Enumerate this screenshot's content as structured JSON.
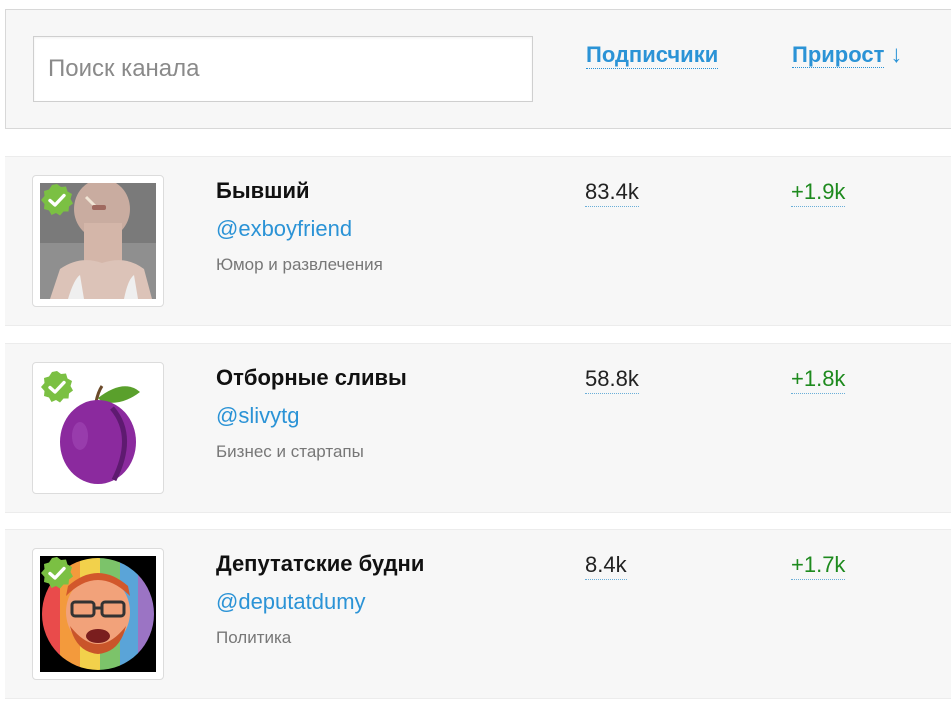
{
  "search": {
    "placeholder": "Поиск канала",
    "value": ""
  },
  "sort": {
    "subscribers_label": "Подписчики",
    "growth_label": "Прирост",
    "growth_arrow": "↓"
  },
  "colors": {
    "link": "#2b93d6",
    "growth": "#1e8a1e",
    "verified": "#7bc043"
  },
  "channels": [
    {
      "name": "Бывший",
      "handle": "@exboyfriend",
      "category": "Юмор и развлечения",
      "subscribers": "83.4k",
      "growth": "+1.9k",
      "avatar": "photo-avatar",
      "verified": true
    },
    {
      "name": "Отборные сливы",
      "handle": "@slivytg",
      "category": "Бизнес и стартапы",
      "subscribers": "58.8k",
      "growth": "+1.8k",
      "avatar": "plum-avatar",
      "verified": true
    },
    {
      "name": "Депутатские будни",
      "handle": "@deputatdumy",
      "category": "Политика",
      "subscribers": "8.4k",
      "growth": "+1.7k",
      "avatar": "cartoon-avatar",
      "verified": true
    }
  ]
}
